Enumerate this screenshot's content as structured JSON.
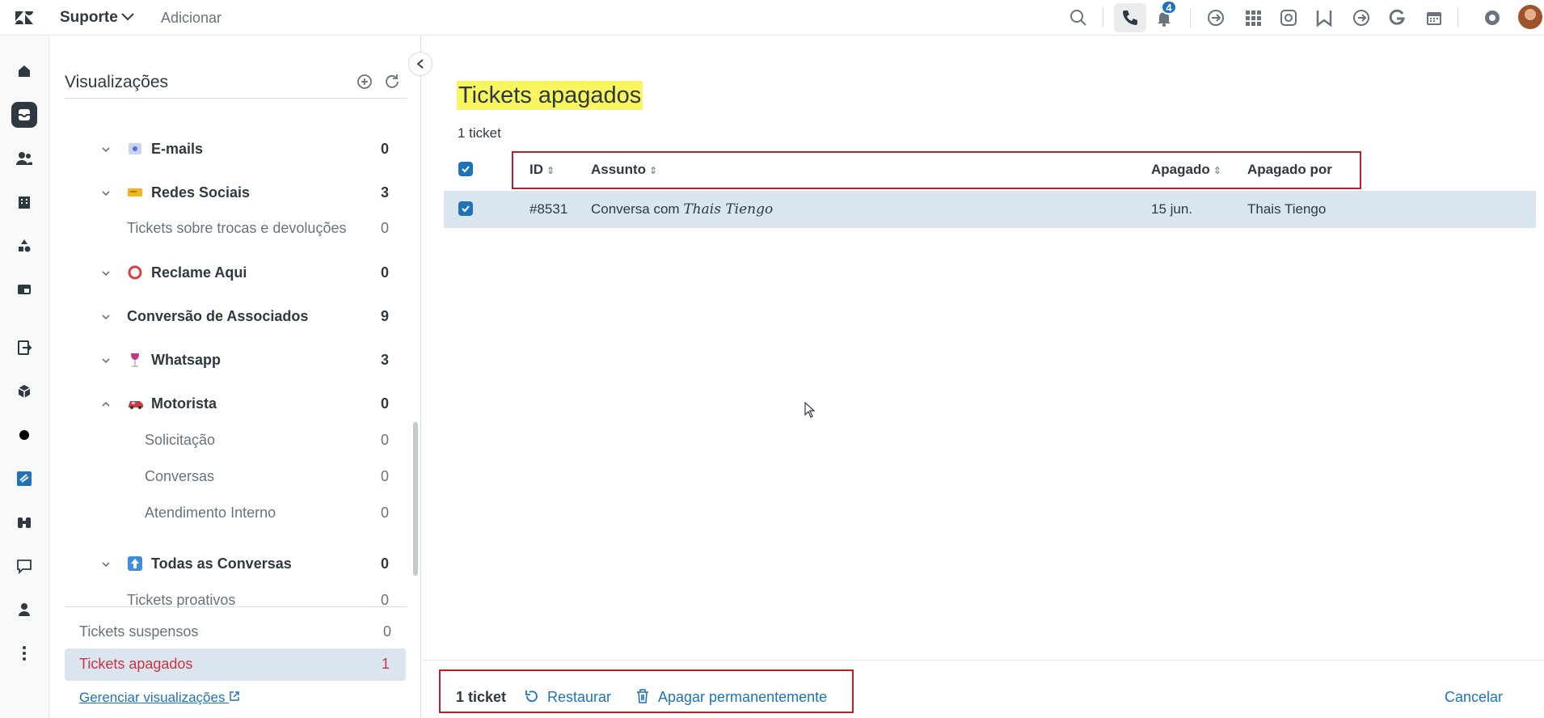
{
  "topbar": {
    "product": "Suporte",
    "add": "Adicionar",
    "notif_count": "4"
  },
  "views": {
    "title": "Visualizações",
    "groups": [
      {
        "label": "E-mails",
        "count": "0",
        "type": "group",
        "emoji": "email"
      },
      {
        "label": "Redes Sociais",
        "count": "3",
        "type": "group",
        "emoji": "ticket"
      },
      {
        "label": "Tickets sobre trocas e devoluções",
        "count": "0",
        "type": "sub0"
      },
      {
        "label": "Reclame Aqui",
        "count": "0",
        "type": "group",
        "emoji": "ring"
      },
      {
        "label": "Conversão de Associados",
        "count": "9",
        "type": "group-noemoji"
      },
      {
        "label": "Whatsapp",
        "count": "3",
        "type": "group",
        "emoji": "glass"
      },
      {
        "label": "Motorista",
        "count": "0",
        "type": "group-open",
        "emoji": "car"
      },
      {
        "label": "Solicitação",
        "count": "0",
        "type": "sub1"
      },
      {
        "label": "Conversas",
        "count": "0",
        "type": "sub1"
      },
      {
        "label": "Atendimento Interno",
        "count": "0",
        "type": "sub1"
      },
      {
        "label": "Todas as Conversas",
        "count": "0",
        "type": "group",
        "emoji": "up"
      },
      {
        "label": "Tickets proativos",
        "count": "0",
        "type": "sub0"
      }
    ],
    "suspended": {
      "label": "Tickets suspensos",
      "count": "0"
    },
    "deleted": {
      "label": "Tickets apagados",
      "count": "1"
    },
    "manage": "Gerenciar visualizações"
  },
  "main": {
    "title": "Tickets apagados",
    "count_text": "1 ticket",
    "columns": {
      "id": "ID",
      "subject": "Assunto",
      "deleted": "Apagado",
      "deleted_by": "Apagado por"
    },
    "row": {
      "id": "#8531",
      "subject_prefix": "Conversa com",
      "subject_name": "Thais Tiengo",
      "deleted": "15 jun.",
      "deleted_by": "Thais Tiengo"
    }
  },
  "footer": {
    "count": "1 ticket",
    "restore": "Restaurar",
    "delete_perm": "Apagar permanentemente",
    "cancel": "Cancelar"
  },
  "colors": {
    "accent": "#1f73b7",
    "highlight": "#f9f55e",
    "annotation": "#b5202a",
    "selected": "#dbe5f0",
    "deleted_link": "#cc3340"
  }
}
